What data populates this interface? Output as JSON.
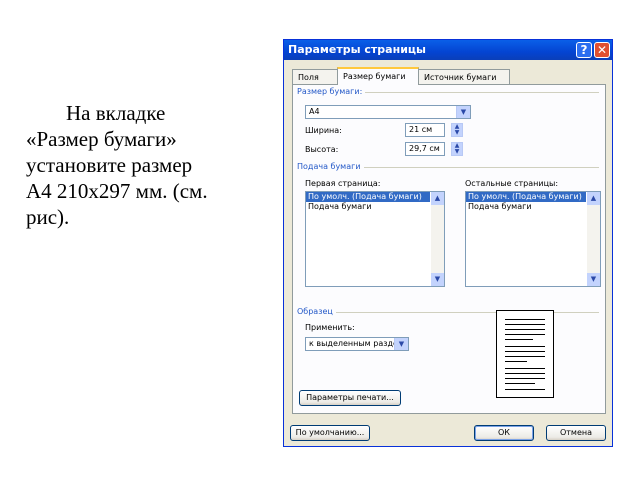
{
  "caption": {
    "line1": "На вкладке",
    "line2": "«Размер бумаги»",
    "line3": "установите размер",
    "line4": "А4 210х297 мм. (см.",
    "line5": "рис)."
  },
  "dialog": {
    "title": "Параметры страницы",
    "help_glyph": "?",
    "close_glyph": "✕",
    "tabs": [
      {
        "label": "Поля"
      },
      {
        "label": "Размер бумаги"
      },
      {
        "label": "Источник бумаги"
      }
    ],
    "paper_size": {
      "group_label": "Размер бумаги:",
      "selected": "A4",
      "width_label": "Ширина:",
      "width_value": "21 см",
      "height_label": "Высота:",
      "height_value": "29,7 см"
    },
    "paper_feed": {
      "group_label": "Подача бумаги",
      "first_page_label": "Первая страница:",
      "first_page_items": [
        "По умолч. (Подача бумаги)",
        "Подача бумаги"
      ],
      "other_pages_label": "Остальные страницы:",
      "other_pages_items": [
        "По умолч. (Подача бумаги)",
        "Подача бумаги"
      ]
    },
    "sample": {
      "group_label": "Образец",
      "apply_label": "Применить:",
      "apply_value": "к выделенным раздел"
    },
    "print_options_button": "Параметры печати...",
    "default_button": "По умолчанию...",
    "ok_button": "ОК",
    "cancel_button": "Отмена"
  }
}
